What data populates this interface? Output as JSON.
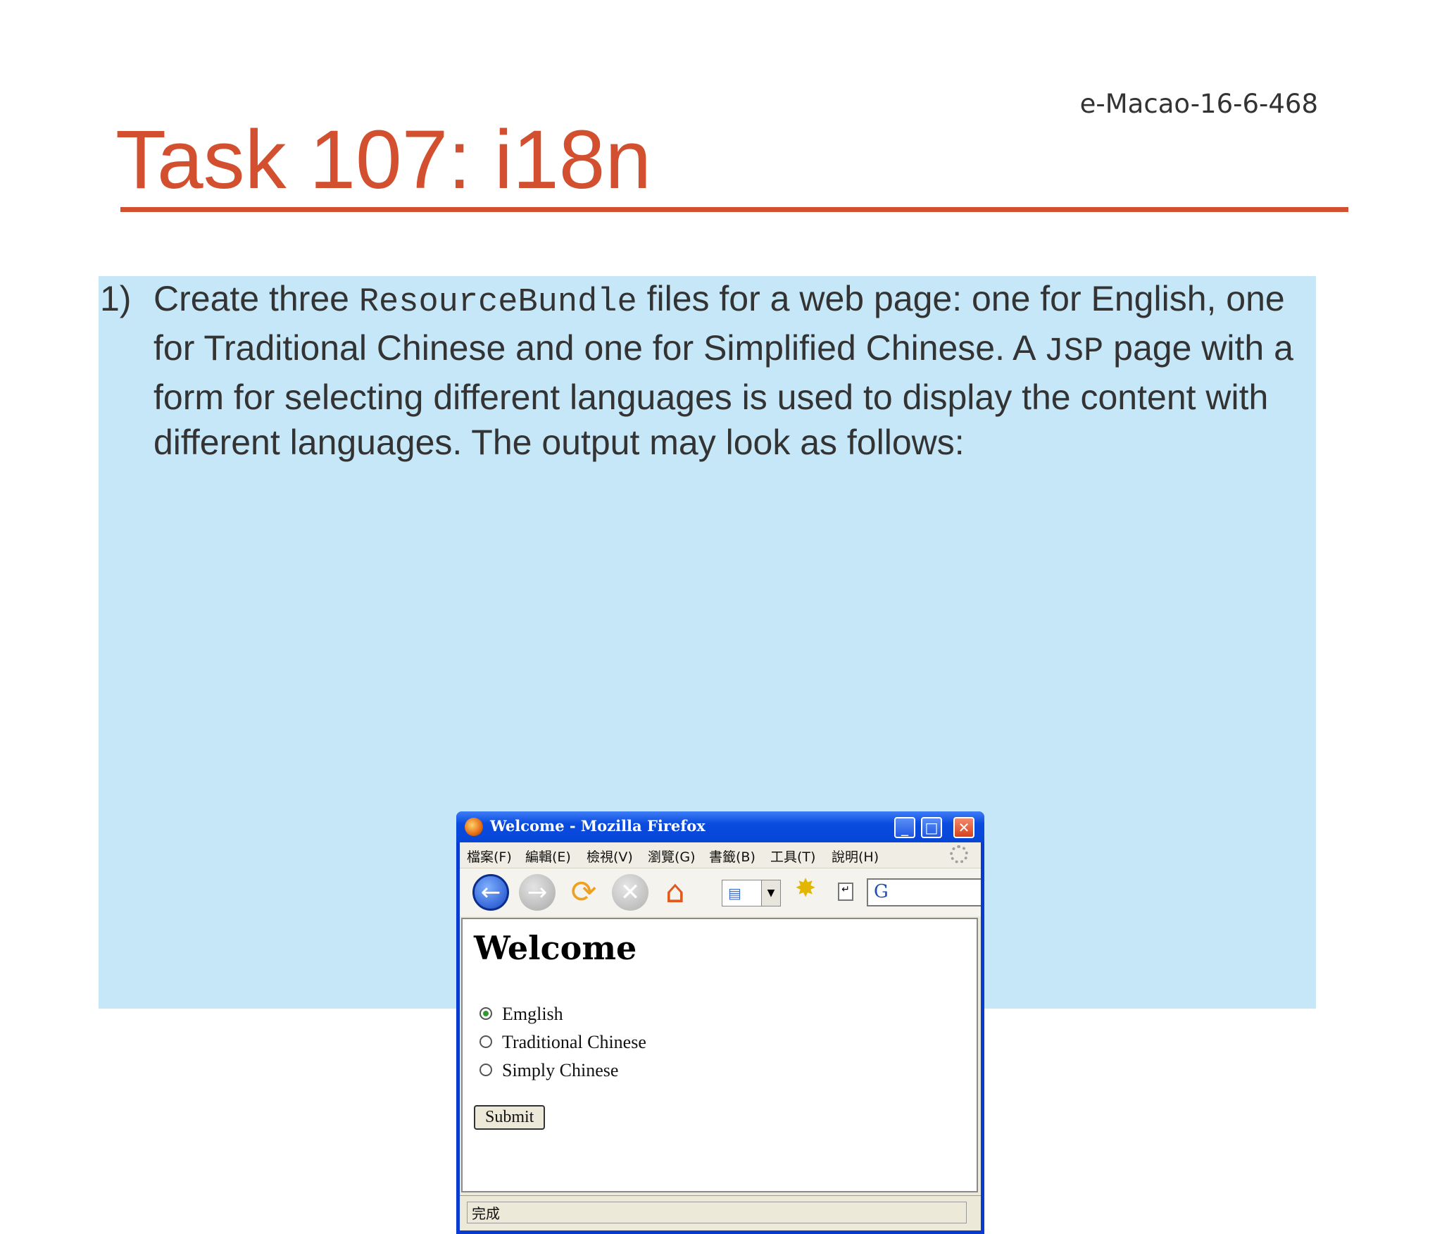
{
  "slide": {
    "id_label": "e-Macao-16-6-468",
    "title": "Task 107: i18n",
    "task": {
      "number": "1)",
      "part1": "Create three ",
      "code1": "ResourceBundle",
      "part2": " files for a web page: one for English, one for Traditional Chinese and one for Simplified Chinese.  A ",
      "code2": "JSP",
      "part3": " page with a form for selecting different languages is used to display the content with different languages.  The output may look as follows:"
    }
  },
  "browser": {
    "window_title": "Welcome - Mozilla Firefox",
    "menu": [
      "檔案(F)",
      "編輯(E)",
      "檢視(V)",
      "瀏覽(G)",
      "書籤(B)",
      "工具(T)",
      "說明(H)"
    ],
    "icons": {
      "app": "firefox-icon",
      "back": "back-arrow-icon",
      "forward": "forward-arrow-icon",
      "reload": "reload-icon",
      "stop": "stop-icon",
      "home": "home-icon",
      "folder": "folder-icon",
      "bookmark": "new-bookmark-icon",
      "search_engine": "google-icon",
      "throbber": "throbber-icon"
    },
    "window_controls": {
      "minimize": "_",
      "maximize": "□",
      "close": "✕"
    },
    "page": {
      "heading": "Welcome",
      "options": [
        {
          "label": "Emglish",
          "selected": true
        },
        {
          "label": "Traditional Chinese",
          "selected": false
        },
        {
          "label": "Simply Chinese",
          "selected": false
        }
      ],
      "submit_label": "Submit"
    },
    "status": "完成"
  }
}
